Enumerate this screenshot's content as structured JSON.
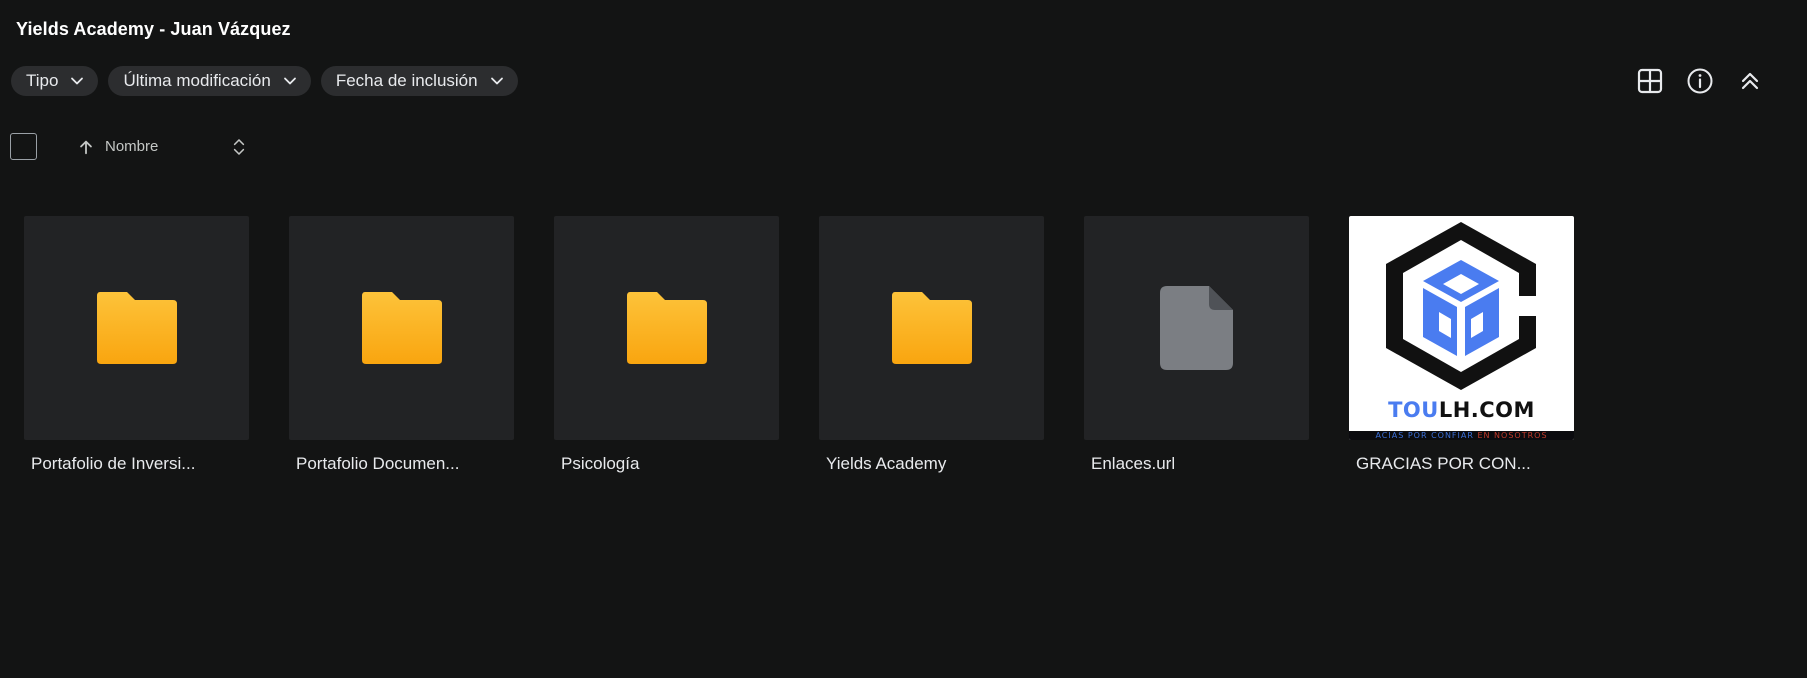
{
  "header": {
    "title": "Yields Academy - Juan Vázquez"
  },
  "filters": [
    {
      "label": "Tipo"
    },
    {
      "label": "Última modificación"
    },
    {
      "label": "Fecha de inclusión"
    }
  ],
  "toolbar": {
    "grid_view_icon": "grid-view-icon",
    "info_icon": "info-icon",
    "collapse_icon": "double-chevron-up-icon"
  },
  "sort": {
    "label": "Nombre",
    "direction": "ascending"
  },
  "items": [
    {
      "name": "Portafolio de Inversi...",
      "type": "folder"
    },
    {
      "name": "Portafolio Documen...",
      "type": "folder"
    },
    {
      "name": "Psicología",
      "type": "folder"
    },
    {
      "name": "Yields Academy",
      "type": "folder"
    },
    {
      "name": "Enlaces.url",
      "type": "file"
    },
    {
      "name": "GRACIAS POR CON...",
      "type": "image",
      "thumb_text_a": "TOU",
      "thumb_text_b": "LH.COM",
      "thumb_strip_a": "ACIAS POR CONFIAR ",
      "thumb_strip_b": "EN NOSOTROS"
    }
  ],
  "colors": {
    "folder": "#fbb42a",
    "file": "#7b7e83",
    "logo_blue": "#4a7cf0",
    "background": "#131414",
    "tile": "#222325"
  }
}
